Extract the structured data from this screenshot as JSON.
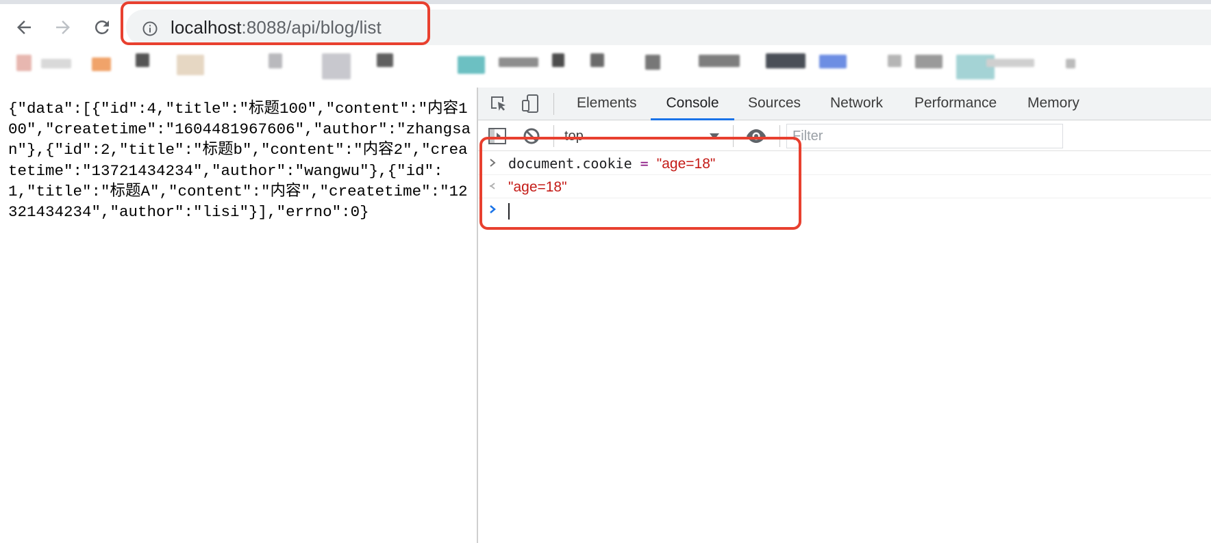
{
  "browser": {
    "url_host": "localhost",
    "url_rest": ":8088/api/blog/list",
    "back_icon": "arrow-left-icon",
    "forward_icon": "arrow-right-icon",
    "reload_icon": "reload-icon",
    "site_info_icon": "info-icon"
  },
  "page": {
    "json_text": "{\"data\":[{\"id\":4,\"title\":\"标题100\",\"content\":\"内容100\",\"createtime\":\"1604481967606\",\"author\":\"zhangsan\"},{\"id\":2,\"title\":\"标题b\",\"content\":\"内容2\",\"createtime\":\"13721434234\",\"author\":\"wangwu\"},{\"id\":1,\"title\":\"标题A\",\"content\":\"内容\",\"createtime\":\"12321434234\",\"author\":\"lisi\"}],\"errno\":0}"
  },
  "devtools": {
    "tabs": [
      "Elements",
      "Console",
      "Sources",
      "Network",
      "Performance",
      "Memory"
    ],
    "active_tab": "Console",
    "context": "top",
    "filter_placeholder": "Filter",
    "console": {
      "input_code": "document.cookie",
      "input_operator": "=",
      "input_value": "\"age=18\"",
      "output_value": "\"age=18\""
    }
  },
  "colors": {
    "highlight": "#e8402f",
    "active_tab_underline": "#1a73e8",
    "string_value": "#c41a16"
  }
}
